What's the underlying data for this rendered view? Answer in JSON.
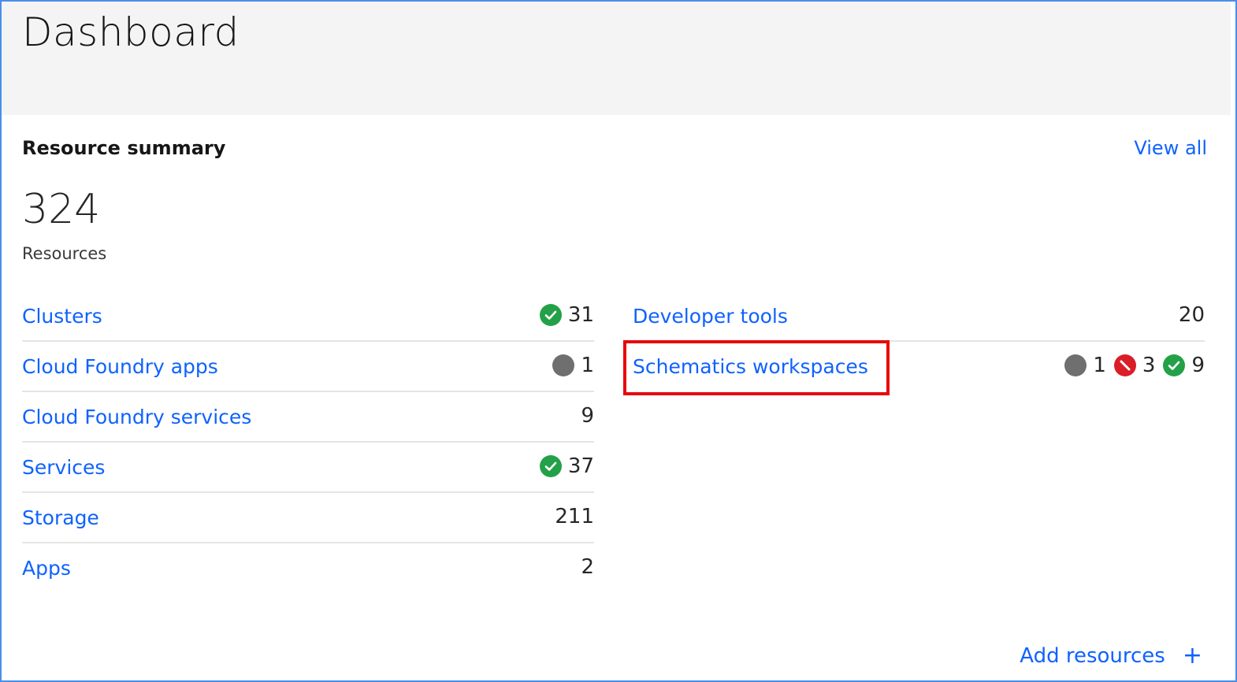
{
  "header": {
    "title": "Dashboard"
  },
  "summary": {
    "title": "Resource summary",
    "view_all_label": "View all",
    "total_count": "324",
    "total_label": "Resources"
  },
  "left_column": [
    {
      "name": "Clusters",
      "stats": [
        {
          "status": "normal",
          "icon": "checkmark-icon",
          "count": "31"
        }
      ]
    },
    {
      "name": "Cloud Foundry apps",
      "stats": [
        {
          "status": "unknown",
          "icon": "gray-dot-icon",
          "count": "1"
        }
      ]
    },
    {
      "name": "Cloud Foundry services",
      "stats": [
        {
          "status": "none",
          "count": "9"
        }
      ]
    },
    {
      "name": "Services",
      "stats": [
        {
          "status": "normal",
          "icon": "checkmark-icon",
          "count": "37"
        }
      ]
    },
    {
      "name": "Storage",
      "stats": [
        {
          "status": "none",
          "count": "211"
        }
      ]
    },
    {
      "name": "Apps",
      "stats": [
        {
          "status": "none",
          "count": "2"
        }
      ]
    }
  ],
  "right_column": [
    {
      "name": "Developer tools",
      "stats": [
        {
          "status": "none",
          "count": "20"
        }
      ]
    },
    {
      "name": "Schematics workspaces",
      "stats": [
        {
          "status": "unknown",
          "icon": "gray-dot-icon",
          "count": "1"
        },
        {
          "status": "error",
          "icon": "blocked-icon",
          "count": "3"
        },
        {
          "status": "normal",
          "icon": "checkmark-icon",
          "count": "9"
        }
      ]
    }
  ],
  "footer": {
    "add_resources_label": "Add resources",
    "add_icon": "plus-icon"
  },
  "colors": {
    "link": "#0f62fe",
    "success": "#24a148",
    "error": "#da1e28",
    "neutral": "#6f6f6f",
    "highlight": "#e8080b"
  }
}
